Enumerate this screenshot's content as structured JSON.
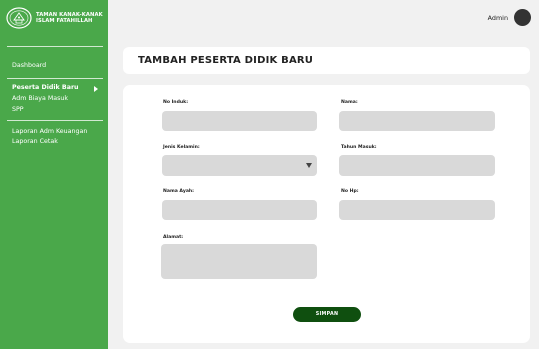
{
  "brand": {
    "name_line1": "TAMAN KANAK-KANAK",
    "name_line2": "ISLAM FATAHILLAH",
    "logo_icon": "school-emblem-icon"
  },
  "sidebar": {
    "items": [
      {
        "label": "Dashboard"
      },
      {
        "label": "Peserta Didik Baru",
        "active": true
      },
      {
        "label": "Adm Biaya Masuk"
      },
      {
        "label": "SPP"
      },
      {
        "label": "Laporan Adm Keuangan"
      },
      {
        "label": "Laporan Cetak"
      }
    ]
  },
  "header": {
    "user_label": "Admin",
    "avatar_icon": "user-avatar-icon"
  },
  "page": {
    "title": "TAMBAH PESERTA DIDIK BARU"
  },
  "form": {
    "no_induk_label": "No Induk:",
    "no_induk_value": "",
    "nama_label": "Nama:",
    "nama_value": "",
    "jenis_kelamin_label": "Jenis Kelamin:",
    "jenis_kelamin_value": "",
    "tahun_masuk_label": "Tahun Masuk:",
    "tahun_masuk_value": "",
    "nama_ayah_label": "Nama Ayah:",
    "nama_ayah_value": "",
    "no_hp_label": "No Hp:",
    "no_hp_value": "",
    "alamat_label": "Alamat:",
    "alamat_value": "",
    "submit_label": "SIMPAN"
  },
  "colors": {
    "sidebar_bg": "#4aa84a",
    "submit_bg": "#0f4f0f",
    "field_bg": "#d9d9d9",
    "page_bg": "#f1f1f1"
  }
}
